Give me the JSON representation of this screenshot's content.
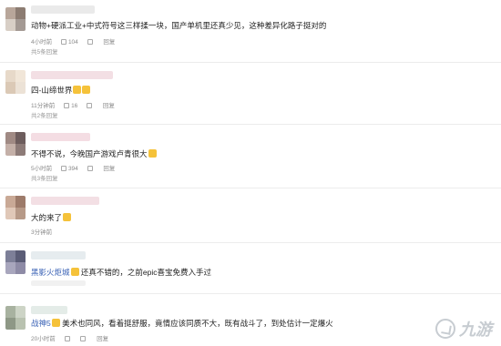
{
  "comments": [
    {
      "text_a": "动物+硬派工业+中式符号这三样揉一块，国产单机里还真少见，这种差异化路子挺对的",
      "time": "4小时前",
      "likes": "104",
      "reply": "回复",
      "replies": "共5条回复"
    },
    {
      "text_a": "四-山缔世界",
      "time": "11分钟前",
      "likes": "16",
      "reply": "回复",
      "replies": "共2条回复"
    },
    {
      "text_a": "不得不说，今晚国产游戏卢青很大",
      "time": "5小时前",
      "likes": "394",
      "reply": "回复",
      "replies": "共3条回复"
    },
    {
      "text_a": "大的来了",
      "time": "3分钟前",
      "likes": "",
      "reply": "",
      "replies": ""
    },
    {
      "text_a_hl": "黑影火炬城",
      "text_a": "还真不错的，之前epic喜宝免费入手过",
      "time": "",
      "likes": "",
      "reply": "",
      "replies": ""
    },
    {
      "text_a_hl": "战神5",
      "text_a": "美术也同风，看着挺舒服，竟情应该同质不大，既有战斗了，到处估计一定爆火",
      "time": "20小时前",
      "likes": "",
      "reply": "回复",
      "replies": ""
    }
  ],
  "watermark": {
    "text": "九游"
  }
}
